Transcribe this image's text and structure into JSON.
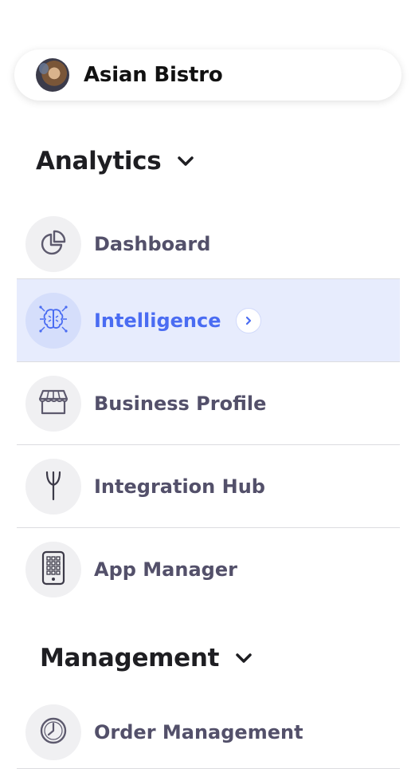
{
  "business": {
    "name": "Asian Bistro"
  },
  "sections": {
    "analytics": {
      "label": "Analytics",
      "items": {
        "dashboard": "Dashboard",
        "intelligence": "Intelligence",
        "business_profile": "Business Profile",
        "integration_hub": "Integration Hub",
        "app_manager": "App Manager"
      }
    },
    "management": {
      "label": "Management",
      "items": {
        "order_management": "Order Management"
      }
    }
  },
  "colors": {
    "active_bg": "#e7ecfd",
    "active_text": "#4a6cf2",
    "item_text": "#53506a",
    "icon_bg": "#f0f0f2"
  },
  "active_item": "intelligence"
}
